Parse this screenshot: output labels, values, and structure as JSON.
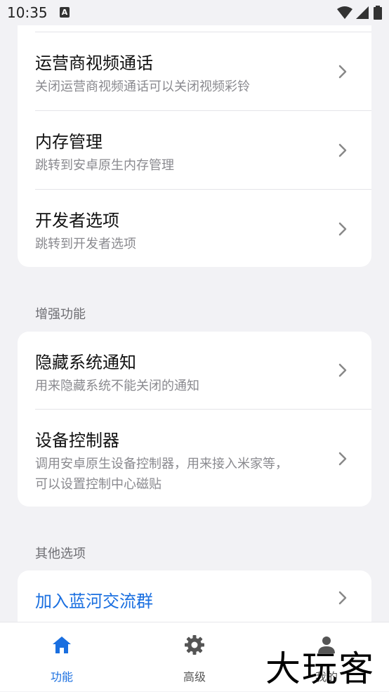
{
  "status": {
    "time": "10:35",
    "notif_badge": "A"
  },
  "card1": {
    "items": [
      {
        "title": "运营商视频通话",
        "subtitle": "关闭运营商视频通话可以关闭视频彩铃"
      },
      {
        "title": "内存管理",
        "subtitle": "跳转到安卓原生内存管理"
      },
      {
        "title": "开发者选项",
        "subtitle": "跳转到开发者选项"
      }
    ]
  },
  "section_enhanced": {
    "label": "增强功能"
  },
  "card2": {
    "items": [
      {
        "title": "隐藏系统通知",
        "subtitle": "用来隐藏系统不能关闭的通知"
      },
      {
        "title": "设备控制器",
        "subtitle_line1": "调用安卓原生设备控制器，用来接入米家等，",
        "subtitle_line2": "可以设置控制中心磁贴"
      }
    ]
  },
  "section_other": {
    "label": "其他选项"
  },
  "card3": {
    "items": [
      {
        "title": "加入蓝河交流群"
      }
    ]
  },
  "bottom_nav": {
    "items": [
      {
        "label": "功能",
        "icon": "home-icon",
        "active": true
      },
      {
        "label": "高级",
        "icon": "gear-icon",
        "active": false
      },
      {
        "label": "我的",
        "icon": "person-icon",
        "active": false
      }
    ]
  },
  "watermark": "大玩客",
  "colors": {
    "accent": "#1a6fe0",
    "background": "#f2f2f5",
    "card": "#ffffff",
    "subtitle": "#8a8a8f"
  }
}
